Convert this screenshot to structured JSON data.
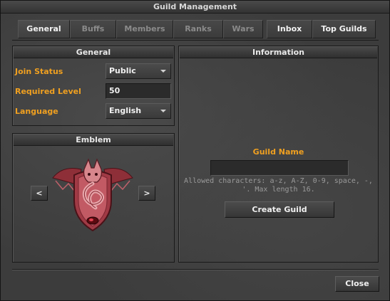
{
  "window": {
    "title": "Guild Management"
  },
  "tabs": [
    {
      "label": "General",
      "state": "active"
    },
    {
      "label": "Buffs",
      "state": "disabled"
    },
    {
      "label": "Members",
      "state": "disabled"
    },
    {
      "label": "Ranks",
      "state": "disabled"
    },
    {
      "label": "Wars",
      "state": "disabled"
    },
    {
      "label": "Inbox",
      "state": "enabled"
    },
    {
      "label": "Top Guilds",
      "state": "enabled"
    }
  ],
  "general": {
    "header": "General",
    "join_status_label": "Join Status",
    "join_status_value": "Public",
    "required_level_label": "Required Level",
    "required_level_value": "50",
    "language_label": "Language",
    "language_value": "English"
  },
  "emblem": {
    "header": "Emblem",
    "prev_label": "<",
    "next_label": ">",
    "icon": "dragon-shield-emblem"
  },
  "information": {
    "header": "Information",
    "guild_name_label": "Guild Name",
    "guild_name_value": "",
    "hint_line1": "Allowed characters: a-z, A-Z, 0-9, space, -,",
    "hint_line2": "'. Max length 16.",
    "create_label": "Create Guild"
  },
  "footer": {
    "close_label": "Close"
  },
  "colors": {
    "accent_orange": "#f0a020",
    "panel_bg": "#3c3c3c",
    "emblem_red": "#b3474f"
  }
}
